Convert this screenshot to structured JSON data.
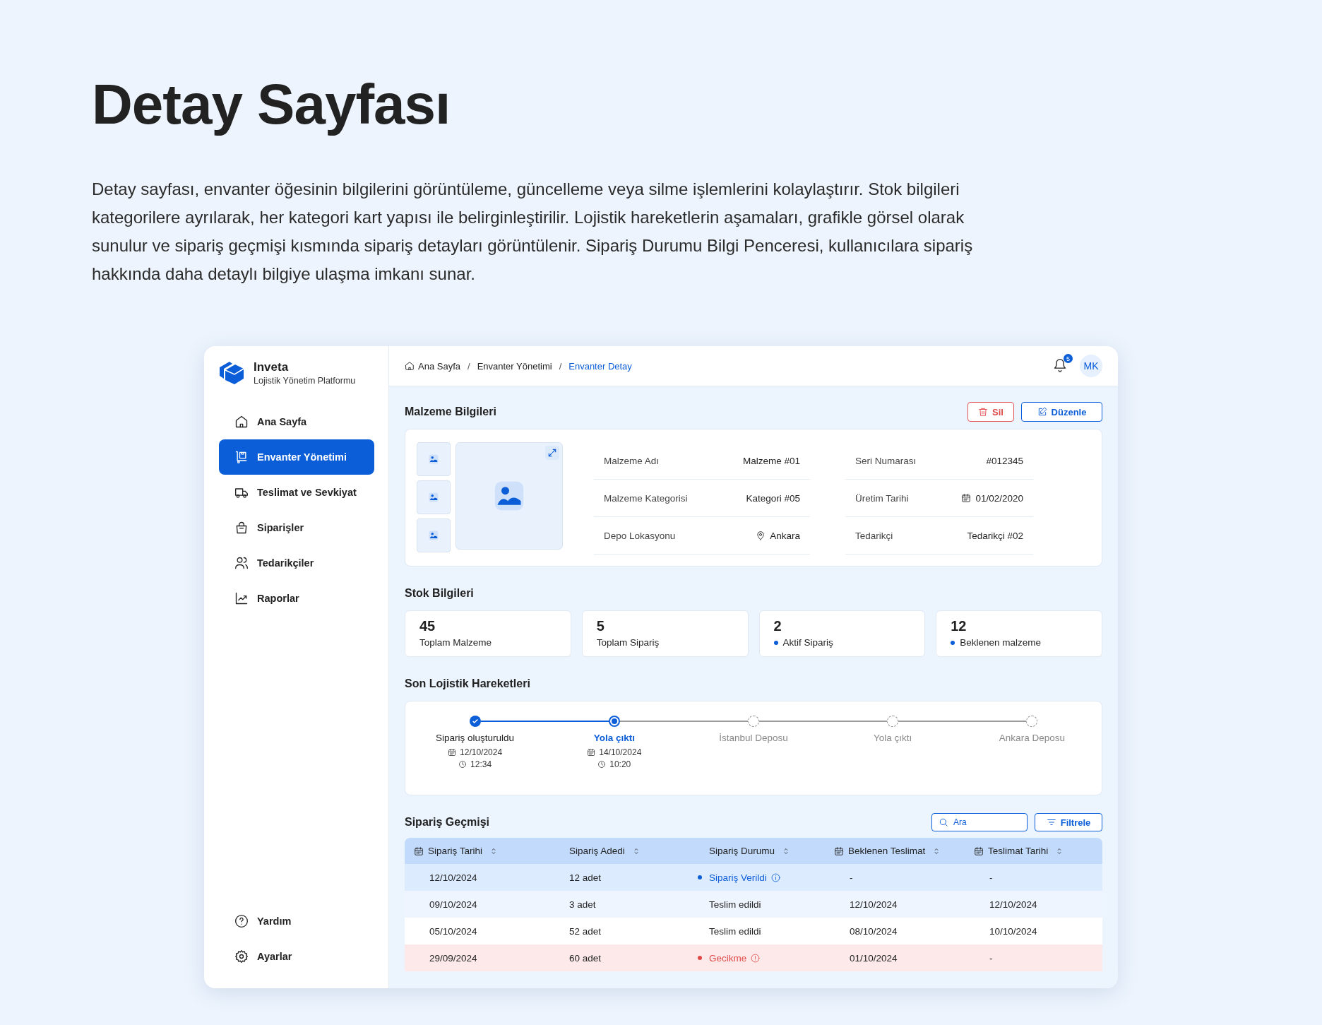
{
  "intro": {
    "title": "Detay Sayfası",
    "description": "Detay sayfası, envanter öğesinin bilgilerini görüntüleme, güncelleme veya silme işlemlerini kolaylaştırır. Stok bilgileri kategorilere ayrılarak, her kategori kart yapısı ile belirginleştirilir. Lojistik hareketlerin aşamaları, grafikle görsel olarak sunulur ve sipariş geçmişi kısmında sipariş detayları görüntülenir. Sipariş Durumu Bilgi Penceresi, kullanıcılara sipariş hakkında daha detaylı bilgiye ulaşma imkanı sunar."
  },
  "app": {
    "brand": {
      "name": "Inveta",
      "tagline": "Lojistik Yönetim Platformu"
    },
    "nav": [
      {
        "label": "Ana Sayfa",
        "selected": false
      },
      {
        "label": "Envanter Yönetimi",
        "selected": true
      },
      {
        "label": "Teslimat ve Sevkiyat",
        "selected": false
      },
      {
        "label": "Siparişler",
        "selected": false
      },
      {
        "label": "Tedarikçiler",
        "selected": false
      },
      {
        "label": "Raporlar",
        "selected": false
      }
    ],
    "nav_bottom": [
      {
        "label": "Yardım"
      },
      {
        "label": "Ayarlar"
      }
    ],
    "breadcrumb": [
      {
        "label": "Ana Sayfa",
        "current": false
      },
      {
        "separator": "/",
        "label": "Envanter Yönetimi",
        "current": false
      },
      {
        "separator": "/",
        "label": "Envanter Detay",
        "current": true
      }
    ],
    "notifications": {
      "count": "5"
    },
    "user": {
      "initials": "MK"
    },
    "material": {
      "title": "Malzeme Bilgileri",
      "actions": [
        {
          "label": "Sil",
          "kind": "delete"
        },
        {
          "label": "Düzenle",
          "kind": "edit"
        }
      ],
      "fields": [
        {
          "label": "Malzeme Adı",
          "value": "Malzeme #01",
          "kind": "text"
        },
        {
          "label": "Seri Numarası",
          "value": "#012345",
          "kind": "text"
        },
        {
          "label": "Malzeme Kategorisi",
          "value": "Kategori #05",
          "kind": "text"
        },
        {
          "label": "Üretim Tarihi",
          "value": "01/02/2020",
          "kind": "date"
        },
        {
          "label": "Depo Lokasyonu",
          "value": "Ankara",
          "kind": "location"
        },
        {
          "label": "Tedarikçi",
          "value": "Tedarikçi #02",
          "kind": "text"
        }
      ]
    },
    "stock": {
      "title": "Stok Bilgileri",
      "stats": [
        {
          "value": "45",
          "label": "Toplam Malzeme",
          "dot": false
        },
        {
          "value": "5",
          "label": "Toplam Sipariş",
          "dot": false
        },
        {
          "value": "2",
          "label": "Aktif Sipariş",
          "dot": true
        },
        {
          "value": "12",
          "label": "Beklenen malzeme",
          "dot": true
        }
      ]
    },
    "logistics": {
      "title": "Son Lojistik Hareketleri",
      "steps": [
        {
          "label": "Sipariş oluşturuldu",
          "kind": "done",
          "date": "12/10/2024",
          "time": "12:34"
        },
        {
          "label": "Yola çıktı",
          "kind": "current",
          "date": "14/10/2024",
          "time": "10:20"
        },
        {
          "label": "İstanbul Deposu",
          "kind": "pending"
        },
        {
          "label": "Yola çıktı",
          "kind": "pending"
        },
        {
          "label": "Ankara Deposu",
          "kind": "pending"
        }
      ]
    },
    "orders": {
      "title": "Sipariş Geçmişi",
      "search": {
        "placeholder": "Ara"
      },
      "filter": "Filtrele",
      "columns": [
        {
          "label": "Sipariş Tarihi",
          "date": true
        },
        {
          "label": "Sipariş Adedi",
          "date": false
        },
        {
          "label": "Sipariş Durumu",
          "date": false
        },
        {
          "label": "Beklenen Teslimat",
          "date": true
        },
        {
          "label": "Teslimat Tarihi",
          "date": true
        }
      ],
      "rows": [
        {
          "selected": true,
          "hovered": false,
          "kind": "placed",
          "cells": [
            "12/10/2024",
            "12 adet",
            "Sipariş Verildi",
            "-",
            "-"
          ]
        },
        {
          "selected": false,
          "hovered": true,
          "kind": "delivered",
          "cells": [
            "09/10/2024",
            "3 adet",
            "Teslim edildi",
            "12/10/2024",
            "12/10/2024"
          ]
        },
        {
          "selected": false,
          "hovered": false,
          "kind": "delivered",
          "cells": [
            "05/10/2024",
            "52 adet",
            "Teslim edildi",
            "08/10/2024",
            "10/10/2024"
          ]
        },
        {
          "selected": false,
          "hovered": false,
          "kind": "delayed",
          "cells": [
            "29/09/2024",
            "60 adet",
            "Gecikme",
            "01/10/2024",
            "-"
          ]
        }
      ]
    }
  }
}
